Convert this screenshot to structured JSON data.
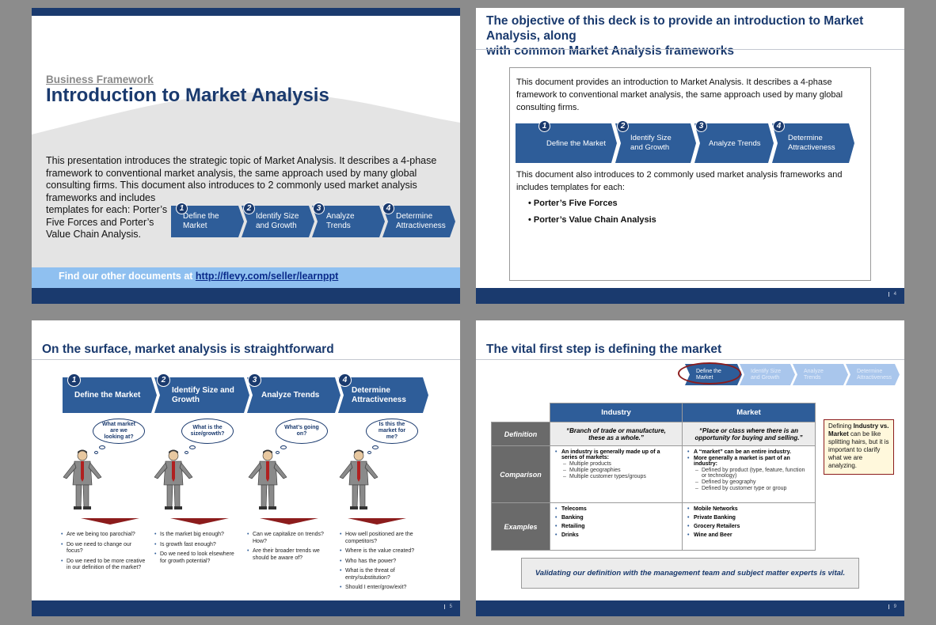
{
  "slide1": {
    "subtitle": "Business Framework",
    "title": "Introduction to Market Analysis",
    "body_line1": "This presentation introduces the strategic topic of Market Analysis.  It describes a 4-phase",
    "body_line2": "framework to conventional market analysis, the same approach used by many global",
    "body_line3": "consulting firms.  This document also introduces to 2 commonly used market analysis",
    "body_line4": "frameworks and includes",
    "body_line5": "templates for each: Porter’s",
    "body_line6": "Five Forces and Porter’s",
    "body_line7": "Value Chain Analysis.",
    "find_text": "Find our other documents at ",
    "find_link": "http://flevy.com/seller/learnppt",
    "phases": [
      {
        "num": "1",
        "label": "Define the Market"
      },
      {
        "num": "2",
        "label": "Identify Size and Growth"
      },
      {
        "num": "3",
        "label": "Analyze Trends"
      },
      {
        "num": "4",
        "label": "Determine Attractiveness"
      }
    ]
  },
  "slide2": {
    "title_line1": "The objective of this deck is to provide an introduction to Market Analysis, along",
    "title_line2": "with common Market Analysis frameworks",
    "para1": "This document provides an introduction to Market Analysis.  It describes a 4-phase framework to conventional market analysis, the same approach used by many global consulting firms.",
    "para2": "This document also introduces to 2 commonly used market analysis frameworks and includes templates for each:",
    "bullet1": "• Porter’s Five Forces",
    "bullet2": "• Porter’s Value Chain Analysis",
    "page": "4"
  },
  "slide3": {
    "title": "On the surface, market analysis is straightforward",
    "page": "5",
    "columns": [
      {
        "num": "1",
        "label": "Define the Market",
        "bubble": "What market are we looking at?",
        "bullets": [
          "Are we being too parochial?",
          "Do we need to change our focus?",
          "Do we need to be more creative in our definition of the market?"
        ]
      },
      {
        "num": "2",
        "label": "Identify Size and Growth",
        "bubble": "What is the size/growth?",
        "bullets": [
          "Is the market big enough?",
          "Is growth fast enough?",
          "Do we need to look elsewhere for growth potential?"
        ]
      },
      {
        "num": "3",
        "label": "Analyze Trends",
        "bubble": "What’s going on?",
        "bullets": [
          "Can we capitalize on trends? How?",
          "Are their broader trends we should be aware of?"
        ]
      },
      {
        "num": "4",
        "label": "Determine Attractiveness",
        "bubble": "Is this the market for me?",
        "bullets": [
          "How well positioned are the competitors?",
          "Where is the value created?",
          "Who has the power?",
          "What is the threat of entry/substitution?",
          "Should I enter/grow/exit?"
        ]
      }
    ]
  },
  "slide4": {
    "title": "The vital first step is defining the market",
    "page": "9",
    "mini_phases": [
      "Define the Market",
      "Identify Size and Growth",
      "Analyze Trends",
      "Determine Attractiveness"
    ],
    "col_industry": "Industry",
    "col_market": "Market",
    "row_definition": "Definition",
    "row_comparison": "Comparison",
    "row_examples": "Examples",
    "def_industry": "“Branch of trade or manufacture, these as a whole.”",
    "def_market": "“Place or class where there is an opportunity for buying and selling.”",
    "cmp_industry_main": "An industry is generally made up of a series of markets:",
    "cmp_industry_subs": [
      "Multiple products",
      "Multiple geographies",
      "Multiple customer types/groups"
    ],
    "cmp_market_main1": "A “market” can be an entire industry.",
    "cmp_market_main2": "More generally a market is part of an industry:",
    "cmp_market_subs": [
      "Defined by product (type, feature, function or technology)",
      "Defined by geography",
      "Defined by customer type or group"
    ],
    "ex_industry": [
      "Telecoms",
      "Banking",
      "Retailing",
      "Drinks"
    ],
    "ex_market": [
      "Mobile Networks",
      "Private Banking",
      "Grocery Retailers",
      "Wine and Beer"
    ],
    "callout_pre": "Defining ",
    "callout_bold": "Industry vs. Market",
    "callout_post": " can be like splitting hairs, but it is important to clarify what we are analyzing.",
    "validate": "Validating our definition with the management team and subject matter experts is vital."
  },
  "colors": {
    "navy": "#1a3a6e",
    "chevron": "#2e5d99",
    "accent_red": "#8c1c1c",
    "light_blue": "#8fc0f0"
  }
}
